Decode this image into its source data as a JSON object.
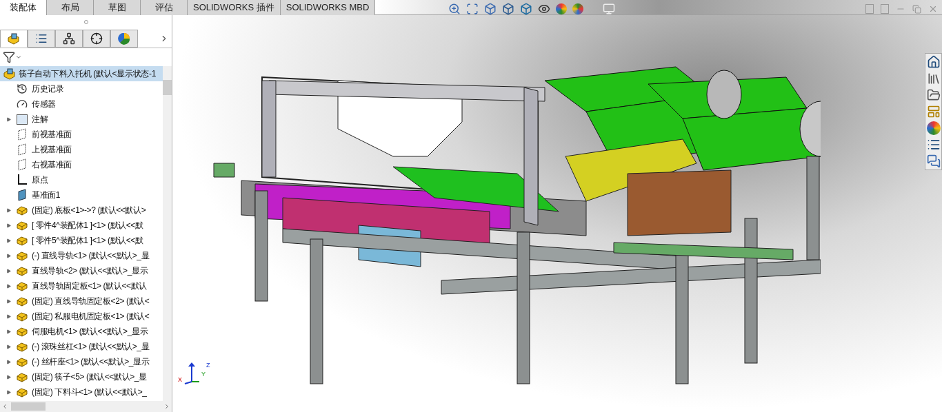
{
  "command_tabs": [
    {
      "label": "装配体",
      "selected": true
    },
    {
      "label": "布局",
      "selected": false
    },
    {
      "label": "草图",
      "selected": false
    },
    {
      "label": "评估",
      "selected": false
    },
    {
      "label": "SOLIDWORKS 插件",
      "selected": false
    },
    {
      "label": "SOLIDWORKS MBD",
      "selected": false
    }
  ],
  "manager_tabs": [
    {
      "kind": "feature",
      "selected": true
    },
    {
      "kind": "property",
      "selected": false
    },
    {
      "kind": "config",
      "selected": false
    },
    {
      "kind": "dim",
      "selected": false
    },
    {
      "kind": "display",
      "selected": false
    }
  ],
  "tree": {
    "label": "筷子自动下料入托机 (默认<显示状态-1",
    "selected": true,
    "children": [
      {
        "kind": "history",
        "label": "历史记录",
        "selected": false
      },
      {
        "kind": "sensor",
        "label": "传感器",
        "selected": false
      },
      {
        "kind": "annotation",
        "label": "注解",
        "selected": false,
        "expanded": false
      },
      {
        "kind": "plane",
        "label": "前视基准面",
        "selected": false
      },
      {
        "kind": "plane",
        "label": "上视基准面",
        "selected": false
      },
      {
        "kind": "plane",
        "label": "右视基准面",
        "selected": false
      },
      {
        "kind": "origin",
        "label": "原点",
        "selected": false
      },
      {
        "kind": "plane-solid",
        "label": "基准面1",
        "selected": false
      },
      {
        "kind": "part",
        "label": "(固定) 底板<1>->? (默认<<默认>",
        "selected": false,
        "expanded": false
      },
      {
        "kind": "part",
        "label": "[ 零件4^装配体1 ]<1> (默认<<默",
        "selected": false,
        "expanded": false
      },
      {
        "kind": "part",
        "label": "[ 零件5^装配体1 ]<1> (默认<<默",
        "selected": false,
        "expanded": false
      },
      {
        "kind": "part",
        "label": "(-) 直线导轨<1> (默认<<默认>_显",
        "selected": false,
        "expanded": false
      },
      {
        "kind": "part",
        "label": "直线导轨<2> (默认<<默认>_显示",
        "selected": false,
        "expanded": false
      },
      {
        "kind": "part",
        "label": "直线导轨固定板<1> (默认<<默认",
        "selected": false,
        "expanded": false
      },
      {
        "kind": "part",
        "label": "(固定) 直线导轨固定板<2> (默认<",
        "selected": false,
        "expanded": false
      },
      {
        "kind": "part",
        "label": "(固定) 私服电机固定板<1> (默认<",
        "selected": false,
        "expanded": false
      },
      {
        "kind": "part",
        "label": "伺服电机<1> (默认<<默认>_显示",
        "selected": false,
        "expanded": false
      },
      {
        "kind": "part",
        "label": "(-) 滚珠丝杠<1> (默认<<默认>_显",
        "selected": false,
        "expanded": false
      },
      {
        "kind": "part",
        "label": "(-) 丝杆座<1> (默认<<默认>_显示",
        "selected": false,
        "expanded": false
      },
      {
        "kind": "part",
        "label": "(固定) 筷子<5> (默认<<默认>_显",
        "selected": false,
        "expanded": false
      },
      {
        "kind": "part",
        "label": "(固定) 下料斗<1> (默认<<默认>_",
        "selected": false,
        "expanded": false
      }
    ]
  },
  "axis_labels": [
    "X",
    "Y",
    "Z"
  ]
}
